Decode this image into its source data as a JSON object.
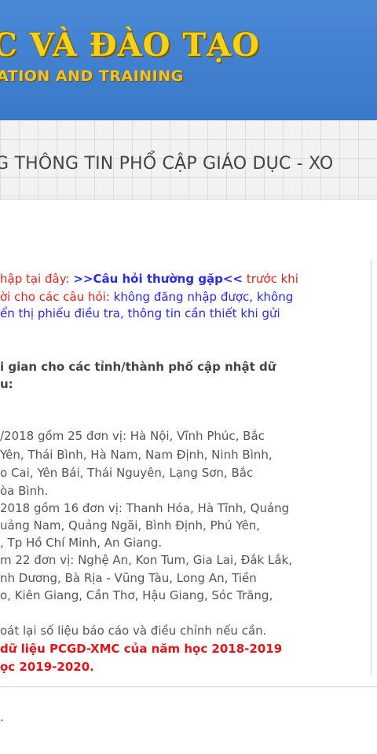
{
  "banner": {
    "title": "C VÀ ĐÀO TẠO",
    "subtitle": "ATION AND TRAINING"
  },
  "header_bar": {
    "title": "G THÔNG TIN PHỔ CẬP GIÁO DỤC - XO"
  },
  "notice": {
    "line1": {
      "pre": "hập tại đây: ",
      "link": ">>Câu hỏi thường gặp<<",
      "post": " trước khi"
    },
    "line2": {
      "pre": "ời cho các câu hỏi: ",
      "post": "không đăng nhập được, không"
    },
    "line3": "ển thị phiếu điều tra, thông tin cần thiết khi gửi"
  },
  "schedule": {
    "heading1": "i gian cho các tỉnh/thành phố cập nhật dữ",
    "heading2": "u:",
    "group1": [
      "/2018 gồm 25 đơn vị: Hà Nội, Vĩnh Phúc, Bắc",
      " Yên, Thái Bình, Hà Nam, Nam Định, Ninh Bình,",
      "o Cai, Yên Bái, Thái Nguyên, Lạng Sơn, Bắc",
      "òa Bình."
    ],
    "group2": [
      "2018 gồm 16 đơn vị: Thanh Hóa, Hà Tĩnh, Quảng",
      "uảng Nam, Quảng Ngãi, Bình Định, Phú Yên,",
      ", Tp Hồ Chí Minh, An Giang."
    ],
    "group3": [
      "m 22 đơn vị: Nghệ An, Kon Tum, Gia Lai, Đắk Lắk,",
      "nh Dương, Bà Rịa - Vũng Tàu, Long An, Tiền",
      "o, Kiên Giang, Cần Thơ, Hậu Giang, Sóc Trăng,"
    ],
    "review": "oát lại số liệu báo cáo và điều chỉnh nếu cần.",
    "warning1": "dữ liệu PCGD-XMC của năm học 2018-2019",
    "warning2": "ọc 2019-2020."
  },
  "footer": {
    "marker": "."
  }
}
